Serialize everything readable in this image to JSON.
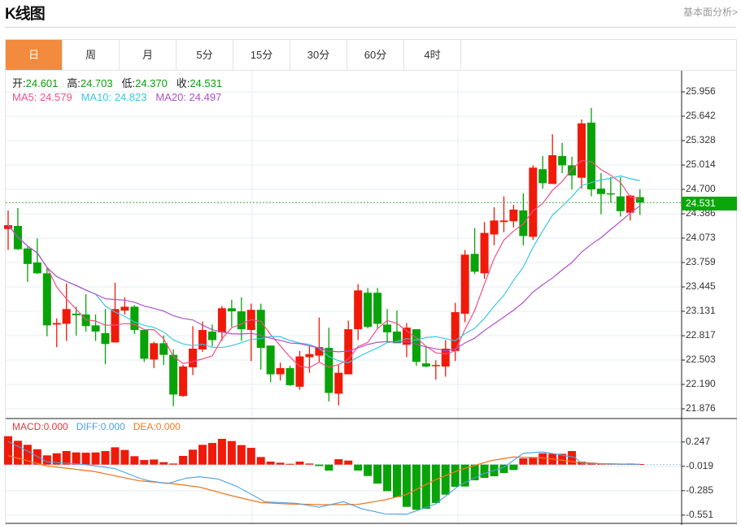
{
  "header": {
    "title": "K线图",
    "link": "基本面分析>"
  },
  "tabs": [
    {
      "label": "日",
      "active": true
    },
    {
      "label": "周"
    },
    {
      "label": "月"
    },
    {
      "label": "5分"
    },
    {
      "label": "15分"
    },
    {
      "label": "30分"
    },
    {
      "label": "60分"
    },
    {
      "label": "4时"
    }
  ],
  "info": {
    "open_label": "开:",
    "open": "24.601",
    "high_label": "高:",
    "high": "24.703",
    "low_label": "低:",
    "low": "24.370",
    "close_label": "收:",
    "close": "24.531",
    "ma5": "MA5: 24.579",
    "ma10": "MA10: 24.823",
    "ma20": "MA20: 24.497"
  },
  "macd_legend": {
    "macd": "MACD:0.000",
    "diff": "DIFF:0.000",
    "dea": "DEA:0.000"
  },
  "current_price": "24.531",
  "colors": {
    "up": "#f01a0a",
    "down": "#08a308",
    "ma5": "#f0508a",
    "ma10": "#3cc6e0",
    "ma20": "#b050c8",
    "macd": "#e8383d",
    "diff": "#4aa0e8",
    "dea": "#f07a20",
    "accent": "#f28b3d"
  },
  "chart_data": [
    {
      "type": "candlestick",
      "yticks": [
        "25.956",
        "25.642",
        "25.328",
        "25.014",
        "24.700",
        "24.386",
        "24.073",
        "23.759",
        "23.445",
        "23.131",
        "22.817",
        "22.503",
        "22.190",
        "21.876"
      ],
      "ylim": [
        21.876,
        25.956
      ],
      "ohlc": [
        [
          24.19,
          24.43,
          23.92,
          24.24
        ],
        [
          24.23,
          24.46,
          23.92,
          23.93
        ],
        [
          23.94,
          23.96,
          23.51,
          23.74
        ],
        [
          23.76,
          24.07,
          23.61,
          23.62
        ],
        [
          23.62,
          23.69,
          22.81,
          22.95
        ],
        [
          22.96,
          23.04,
          22.67,
          22.98
        ],
        [
          22.97,
          23.49,
          22.75,
          23.16
        ],
        [
          23.1,
          23.19,
          22.82,
          23.08
        ],
        [
          23.09,
          23.35,
          22.87,
          22.94
        ],
        [
          22.95,
          23.09,
          22.75,
          22.87
        ],
        [
          22.85,
          23.16,
          22.45,
          22.71
        ],
        [
          22.73,
          23.5,
          22.73,
          23.16
        ],
        [
          23.14,
          23.31,
          23.09,
          23.19
        ],
        [
          23.19,
          23.21,
          22.84,
          22.89
        ],
        [
          22.89,
          22.9,
          22.48,
          22.52
        ],
        [
          22.51,
          22.74,
          22.4,
          22.72
        ],
        [
          22.72,
          22.82,
          22.44,
          22.57
        ],
        [
          22.57,
          22.64,
          21.91,
          22.06
        ],
        [
          22.04,
          22.44,
          22.03,
          22.42
        ],
        [
          22.41,
          22.94,
          22.31,
          22.65
        ],
        [
          22.64,
          23.0,
          22.61,
          22.89
        ],
        [
          22.87,
          22.96,
          22.68,
          22.76
        ],
        [
          22.86,
          23.2,
          22.75,
          23.17
        ],
        [
          23.17,
          23.28,
          22.93,
          23.13
        ],
        [
          23.13,
          23.31,
          22.75,
          22.9
        ],
        [
          22.89,
          23.23,
          22.49,
          23.15
        ],
        [
          23.15,
          23.23,
          22.38,
          22.66
        ],
        [
          22.69,
          22.69,
          22.22,
          22.32
        ],
        [
          22.32,
          22.47,
          22.24,
          22.4
        ],
        [
          22.4,
          22.43,
          22.17,
          22.18
        ],
        [
          22.16,
          22.62,
          22.12,
          22.55
        ],
        [
          22.54,
          22.68,
          22.34,
          22.58
        ],
        [
          22.56,
          23.05,
          22.48,
          22.67
        ],
        [
          22.66,
          22.92,
          21.97,
          22.08
        ],
        [
          22.07,
          22.44,
          21.92,
          22.34
        ],
        [
          22.32,
          23.01,
          22.32,
          22.9
        ],
        [
          22.9,
          23.48,
          22.76,
          23.4
        ],
        [
          23.37,
          23.43,
          22.91,
          22.93
        ],
        [
          23.37,
          23.43,
          22.9,
          22.97
        ],
        [
          22.96,
          23.16,
          22.73,
          22.86
        ],
        [
          22.87,
          23.14,
          22.72,
          22.72
        ],
        [
          22.7,
          22.98,
          22.54,
          22.92
        ],
        [
          22.9,
          22.9,
          22.43,
          22.48
        ],
        [
          22.46,
          22.68,
          22.41,
          22.42
        ],
        [
          22.43,
          22.5,
          22.25,
          22.44
        ],
        [
          22.42,
          22.76,
          22.29,
          22.65
        ],
        [
          22.62,
          23.24,
          22.49,
          23.12
        ],
        [
          23.1,
          23.92,
          22.99,
          23.86
        ],
        [
          23.87,
          24.2,
          23.61,
          23.64
        ],
        [
          23.62,
          24.28,
          23.55,
          24.14
        ],
        [
          24.12,
          24.47,
          23.98,
          24.3
        ],
        [
          24.28,
          24.61,
          24.15,
          24.3
        ],
        [
          24.29,
          24.5,
          24.21,
          24.44
        ],
        [
          24.43,
          24.65,
          23.98,
          24.1
        ],
        [
          24.09,
          25.01,
          24.05,
          24.98
        ],
        [
          24.96,
          25.13,
          24.71,
          24.78
        ],
        [
          24.77,
          25.41,
          24.77,
          25.14
        ],
        [
          25.13,
          25.3,
          24.91,
          25.01
        ],
        [
          25.01,
          25.12,
          24.7,
          24.88
        ],
        [
          24.85,
          25.6,
          24.71,
          25.55
        ],
        [
          25.56,
          25.75,
          24.61,
          24.7
        ],
        [
          24.71,
          24.91,
          24.38,
          24.64
        ],
        [
          24.65,
          24.86,
          24.53,
          24.64
        ],
        [
          24.61,
          24.86,
          24.35,
          24.42
        ],
        [
          24.4,
          24.63,
          24.3,
          24.62
        ],
        [
          24.601,
          24.703,
          24.37,
          24.531
        ]
      ],
      "ma_periods": [
        5,
        10,
        20
      ]
    },
    {
      "type": "macd",
      "yticks": [
        "0.247",
        "-0.019",
        "-0.285",
        "-0.551"
      ],
      "hist": [
        0.31,
        0.26,
        0.216,
        0.168,
        0.101,
        0.124,
        0.148,
        0.133,
        0.13,
        0.133,
        0.148,
        0.189,
        0.16,
        0.092,
        0.05,
        0.056,
        0.027,
        0.012,
        0.095,
        0.163,
        0.216,
        0.236,
        0.281,
        0.257,
        0.213,
        0.183,
        0.083,
        0.033,
        0.021,
        0.009,
        0.033,
        0.012,
        -0.015,
        -0.065,
        0.059,
        0.044,
        -0.065,
        -0.124,
        -0.207,
        -0.29,
        -0.355,
        -0.461,
        -0.493,
        -0.482,
        -0.419,
        -0.328,
        -0.242,
        -0.239,
        -0.171,
        -0.145,
        -0.127,
        -0.092,
        -0.059,
        0.068,
        0.083,
        0.124,
        0.118,
        0.118,
        0.148,
        0.033,
        0.021,
        0.012,
        0.012,
        0.009,
        0.012,
        0.006
      ],
      "dif": [
        [
          0,
          0.251
        ],
        [
          2,
          0.148
        ],
        [
          4,
          0.03
        ],
        [
          6,
          0.015
        ],
        [
          8,
          0.0
        ],
        [
          11,
          -0.044
        ],
        [
          13.5,
          -0.148
        ],
        [
          14.5,
          -0.177
        ],
        [
          16.4,
          -0.207
        ],
        [
          18.3,
          -0.148
        ],
        [
          19.7,
          -0.133
        ],
        [
          21.6,
          -0.157
        ],
        [
          23.5,
          -0.236
        ],
        [
          26.4,
          -0.405
        ],
        [
          29.7,
          -0.423
        ],
        [
          32,
          -0.464
        ],
        [
          34.5,
          -0.405
        ],
        [
          36.4,
          -0.482
        ],
        [
          38.8,
          -0.538
        ],
        [
          41,
          -0.541
        ],
        [
          44,
          -0.428
        ],
        [
          46.4,
          -0.227
        ],
        [
          48.8,
          -0.103
        ],
        [
          51,
          -0.03
        ],
        [
          53,
          0.124
        ],
        [
          55,
          0.139
        ],
        [
          58.3,
          0.08
        ],
        [
          59,
          0.015
        ],
        [
          63,
          0.006
        ],
        [
          65,
          0.003
        ]
      ],
      "dea": [
        [
          0,
          0.098
        ],
        [
          4,
          -0.015
        ],
        [
          8.8,
          -0.074
        ],
        [
          13.5,
          -0.177
        ],
        [
          16.9,
          -0.207
        ],
        [
          19.7,
          -0.245
        ],
        [
          23,
          -0.34
        ],
        [
          26,
          -0.414
        ],
        [
          28.8,
          -0.429
        ],
        [
          32.6,
          -0.437
        ],
        [
          36,
          -0.434
        ],
        [
          38.8,
          -0.384
        ],
        [
          41,
          -0.325
        ],
        [
          44,
          -0.163
        ],
        [
          46.4,
          -0.059
        ],
        [
          49.7,
          0.044
        ],
        [
          52,
          0.083
        ],
        [
          55,
          0.074
        ],
        [
          58.3,
          0.03
        ],
        [
          61,
          0.009
        ],
        [
          65,
          0.003
        ]
      ]
    }
  ]
}
